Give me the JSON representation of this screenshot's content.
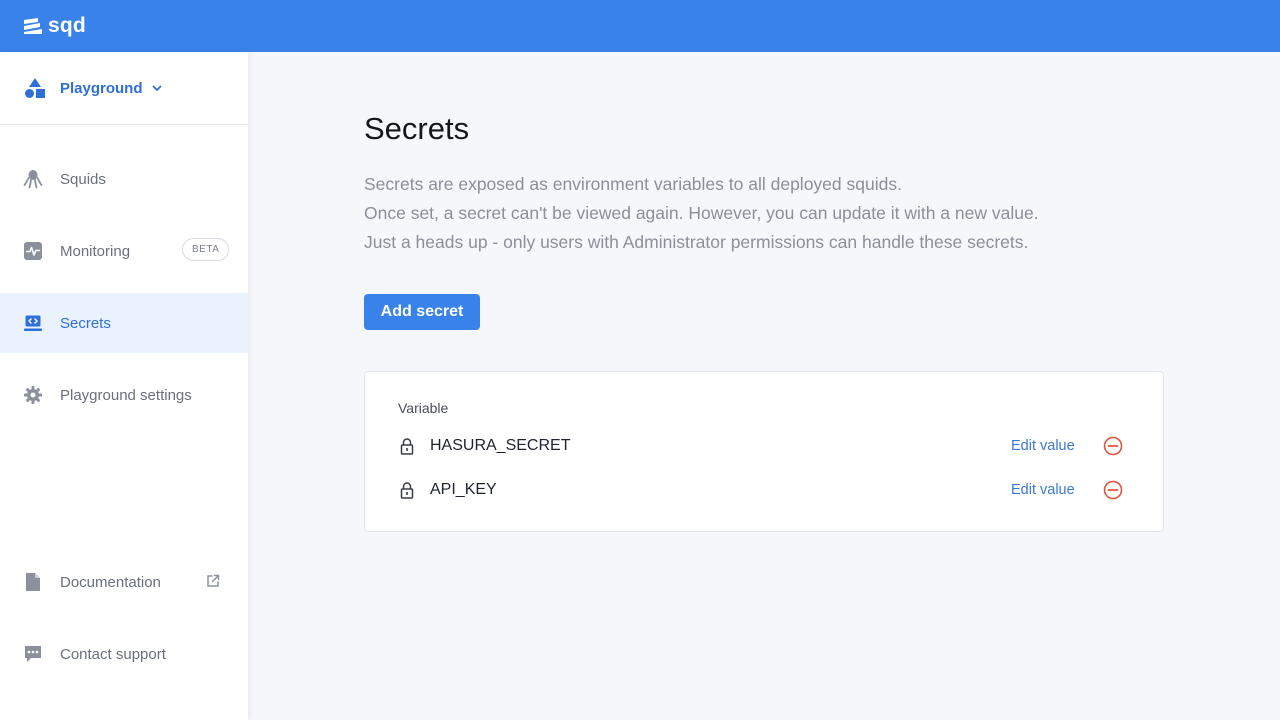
{
  "header": {
    "logo_text": "sqd"
  },
  "sidebar": {
    "org": {
      "name": "Playground"
    },
    "items": [
      {
        "label": "Squids",
        "icon": "squid-icon"
      },
      {
        "label": "Monitoring",
        "icon": "monitoring-icon",
        "badge": "BETA"
      },
      {
        "label": "Secrets",
        "icon": "secrets-icon",
        "active": true
      },
      {
        "label": "Playground settings",
        "icon": "gear-icon"
      },
      {
        "label": "Documentation",
        "icon": "document-icon",
        "external": true
      },
      {
        "label": "Contact support",
        "icon": "chat-icon"
      }
    ]
  },
  "main": {
    "title": "Secrets",
    "description": [
      "Secrets are exposed as environment variables to all deployed squids.",
      "Once set, a secret can't be viewed again. However, you can update it with a new value.",
      "Just a heads up - only users with Administrator permissions can handle these secrets."
    ],
    "add_button": "Add secret",
    "table": {
      "column_header": "Variable",
      "rows": [
        {
          "name": "HASURA_SECRET",
          "action": "Edit value"
        },
        {
          "name": "API_KEY",
          "action": "Edit value"
        }
      ]
    }
  },
  "colors": {
    "brand": "#3982ea",
    "active_text": "#2f6fd8",
    "active_bg": "#eaf2fd",
    "danger": "#e5533d"
  }
}
